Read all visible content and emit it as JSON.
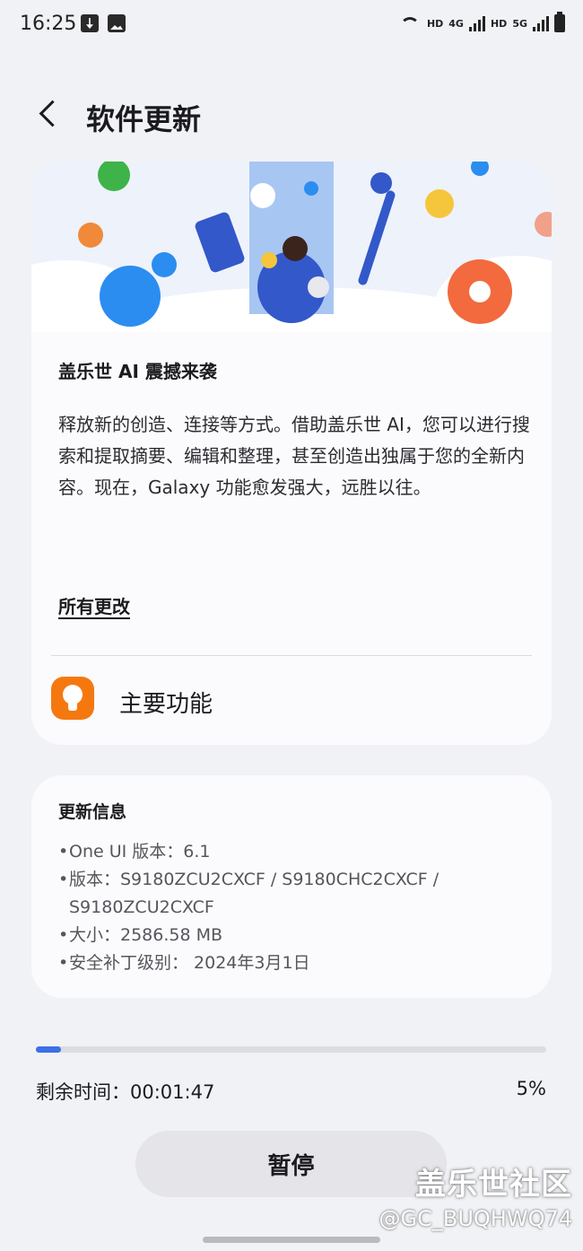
{
  "status_bar": {
    "time": "16:25",
    "network_labels": [
      "HD",
      "4G",
      "HD",
      "5G"
    ]
  },
  "header": {
    "title": "软件更新"
  },
  "main_card": {
    "banner_colors": [
      "#3db34a",
      "#2b8df0",
      "#f08a3a",
      "#f5c63c",
      "#3358c9"
    ],
    "ai_title": "盖乐世 AI 震撼来袭",
    "ai_description": "释放新的创造、连接等方式。借助盖乐世 AI，您可以进行搜索和提取摘要、编辑和整理，甚至创造出独属于您的全新内容。现在，Galaxy 功能愈发强大，远胜以往。",
    "all_changes_link": "所有更改",
    "feature_label": "主要功能"
  },
  "update_info": {
    "title": "更新信息",
    "items": [
      "One UI 版本：6.1",
      "版本：S9180ZCU2CXCF / S9180CHC2CXCF / S9180ZCU2CXCF",
      "大小：2586.58 MB",
      "安全补丁级别： 2024年3月1日"
    ]
  },
  "progress": {
    "fraction": 0.05,
    "remaining_text": "剩余时间：00:01:47",
    "percent_text": "5%"
  },
  "pause_button": {
    "label": "暂停"
  },
  "watermark": {
    "line1": "盖乐世社区",
    "line2": "@GC_BUQHWQ74"
  }
}
